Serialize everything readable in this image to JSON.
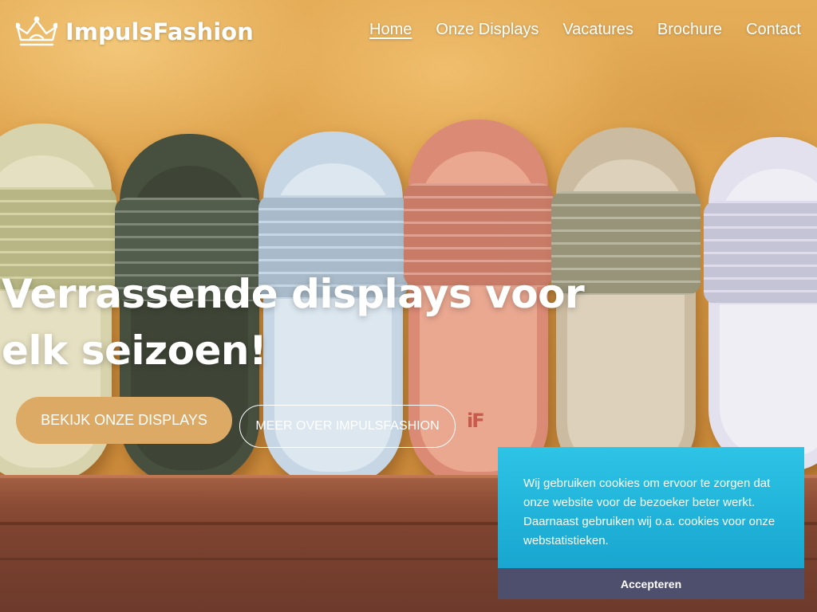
{
  "header": {
    "logo_text": "ImpulsFashion",
    "logo_icon": "crown-icon",
    "nav": [
      {
        "label": "Home",
        "active": true
      },
      {
        "label": "Onze Displays",
        "active": false
      },
      {
        "label": "Vacatures",
        "active": false
      },
      {
        "label": "Brochure",
        "active": false
      },
      {
        "label": "Contact",
        "active": false
      }
    ]
  },
  "hero": {
    "title": "Verrassende displays voor elk seizoen!",
    "primary_button": "Bekijk onze displays",
    "secondary_button": "Meer over ImpulsFashion",
    "product_mark": "iF"
  },
  "cookie_banner": {
    "text": "Wij gebruiken cookies om ervoor te zorgen dat onze website voor de bezoeker beter werkt. Daarnaast gebruiken wij o.a. cookies voor onze webstatistieken.",
    "accept_label": "Accepteren"
  },
  "colors": {
    "accent": "#ddaa66",
    "cookie_bg": "#1aa9d2",
    "cookie_button": "#4d4f6c"
  }
}
